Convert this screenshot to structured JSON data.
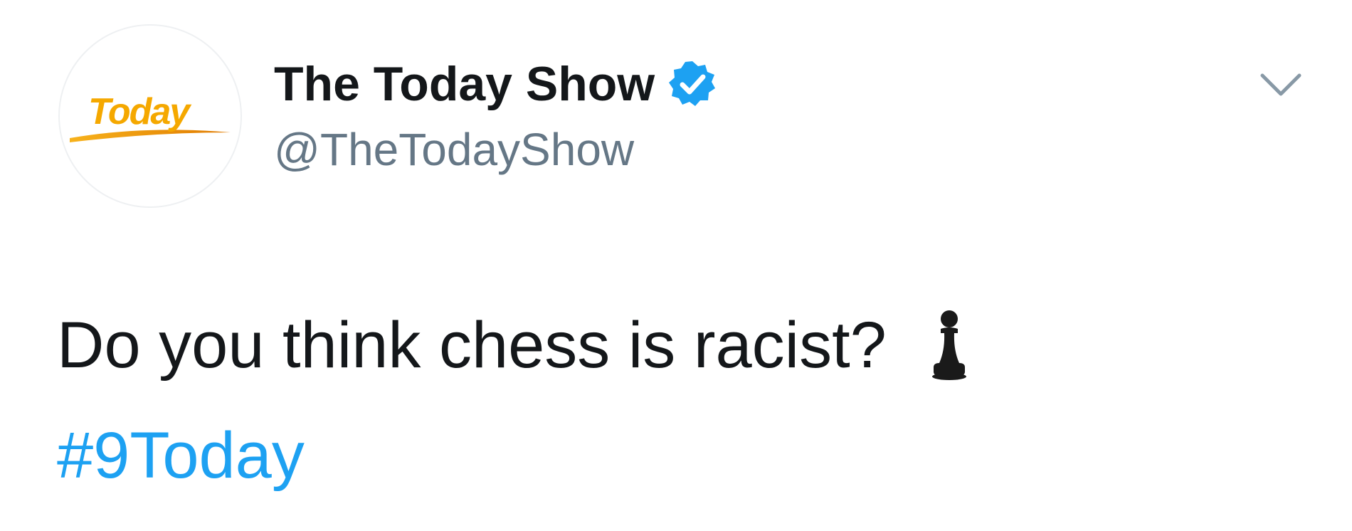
{
  "account": {
    "display_name": "The Today Show",
    "handle": "@TheTodayShow",
    "avatar_logo_text": "Today",
    "verified": true
  },
  "icons": {
    "verified": "verified-badge-icon",
    "caret": "chevron-down-icon",
    "pawn": "chess-pawn-emoji"
  },
  "tweet": {
    "text": "Do you think chess is racist?",
    "hashtag": "#9Today"
  },
  "colors": {
    "name": "#14171a",
    "handle": "#657786",
    "link": "#1da1f2",
    "verified": "#1da1f2",
    "logo_text": "#f5a800",
    "logo_swoosh": "#f28c00"
  }
}
